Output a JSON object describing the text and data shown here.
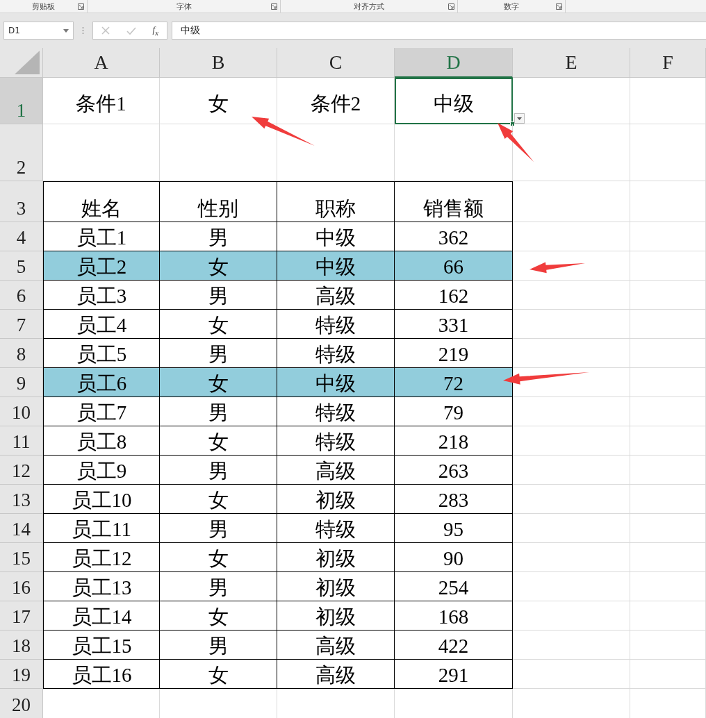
{
  "ribbon_groups": [
    {
      "label": "剪贴板"
    },
    {
      "label": "字体"
    },
    {
      "label": "对齐方式"
    },
    {
      "label": "数字"
    }
  ],
  "formula_bar": {
    "name_box": "D1",
    "function_label": "f$_{x}$",
    "formula": "中级"
  },
  "columns": [
    {
      "label": "A",
      "selected": false
    },
    {
      "label": "B",
      "selected": false
    },
    {
      "label": "C",
      "selected": false
    },
    {
      "label": "D",
      "selected": true
    },
    {
      "label": "E",
      "selected": false
    },
    {
      "label": "F",
      "selected": false
    }
  ],
  "rows": [
    {
      "number": "1",
      "kind": "criteria",
      "selected": true,
      "cells": [
        {
          "text": "条件1",
          "selected": false
        },
        {
          "text": "女",
          "selected": false
        },
        {
          "text": "条件2",
          "selected": false
        },
        {
          "text": "中级",
          "selected": true
        }
      ]
    },
    {
      "number": "2",
      "kind": "blank",
      "selected": false
    },
    {
      "number": "3",
      "kind": "header",
      "selected": false,
      "cells": [
        {
          "text": "姓名"
        },
        {
          "text": "性别"
        },
        {
          "text": "职称"
        },
        {
          "text": "销售额"
        }
      ]
    },
    {
      "number": "4",
      "kind": "data",
      "selected": false,
      "highlighted": false,
      "cells": [
        {
          "text": "员工1"
        },
        {
          "text": "男"
        },
        {
          "text": "中级"
        },
        {
          "text": "362"
        }
      ]
    },
    {
      "number": "5",
      "kind": "data",
      "selected": false,
      "highlighted": true,
      "cells": [
        {
          "text": "员工2"
        },
        {
          "text": "女"
        },
        {
          "text": "中级"
        },
        {
          "text": "66"
        }
      ]
    },
    {
      "number": "6",
      "kind": "data",
      "selected": false,
      "highlighted": false,
      "cells": [
        {
          "text": "员工3"
        },
        {
          "text": "男"
        },
        {
          "text": "高级"
        },
        {
          "text": "162"
        }
      ]
    },
    {
      "number": "7",
      "kind": "data",
      "selected": false,
      "highlighted": false,
      "cells": [
        {
          "text": "员工4"
        },
        {
          "text": "女"
        },
        {
          "text": "特级"
        },
        {
          "text": "331"
        }
      ]
    },
    {
      "number": "8",
      "kind": "data",
      "selected": false,
      "highlighted": false,
      "cells": [
        {
          "text": "员工5"
        },
        {
          "text": "男"
        },
        {
          "text": "特级"
        },
        {
          "text": "219"
        }
      ]
    },
    {
      "number": "9",
      "kind": "data",
      "selected": false,
      "highlighted": true,
      "cells": [
        {
          "text": "员工6"
        },
        {
          "text": "女"
        },
        {
          "text": "中级"
        },
        {
          "text": "72"
        }
      ]
    },
    {
      "number": "10",
      "kind": "data",
      "selected": false,
      "highlighted": false,
      "cells": [
        {
          "text": "员工7"
        },
        {
          "text": "男"
        },
        {
          "text": "特级"
        },
        {
          "text": "79"
        }
      ]
    },
    {
      "number": "11",
      "kind": "data",
      "selected": false,
      "highlighted": false,
      "cells": [
        {
          "text": "员工8"
        },
        {
          "text": "女"
        },
        {
          "text": "特级"
        },
        {
          "text": "218"
        }
      ]
    },
    {
      "number": "12",
      "kind": "data",
      "selected": false,
      "highlighted": false,
      "cells": [
        {
          "text": "员工9"
        },
        {
          "text": "男"
        },
        {
          "text": "高级"
        },
        {
          "text": "263"
        }
      ]
    },
    {
      "number": "13",
      "kind": "data",
      "selected": false,
      "highlighted": false,
      "cells": [
        {
          "text": "员工10"
        },
        {
          "text": "女"
        },
        {
          "text": "初级"
        },
        {
          "text": "283"
        }
      ]
    },
    {
      "number": "14",
      "kind": "data",
      "selected": false,
      "highlighted": false,
      "cells": [
        {
          "text": "员工11"
        },
        {
          "text": "男"
        },
        {
          "text": "特级"
        },
        {
          "text": "95"
        }
      ]
    },
    {
      "number": "15",
      "kind": "data",
      "selected": false,
      "highlighted": false,
      "cells": [
        {
          "text": "员工12"
        },
        {
          "text": "女"
        },
        {
          "text": "初级"
        },
        {
          "text": "90"
        }
      ]
    },
    {
      "number": "16",
      "kind": "data",
      "selected": false,
      "highlighted": false,
      "cells": [
        {
          "text": "员工13"
        },
        {
          "text": "男"
        },
        {
          "text": "初级"
        },
        {
          "text": "254"
        }
      ]
    },
    {
      "number": "17",
      "kind": "data",
      "selected": false,
      "highlighted": false,
      "cells": [
        {
          "text": "员工14"
        },
        {
          "text": "女"
        },
        {
          "text": "初级"
        },
        {
          "text": "168"
        }
      ]
    },
    {
      "number": "18",
      "kind": "data",
      "selected": false,
      "highlighted": false,
      "cells": [
        {
          "text": "员工15"
        },
        {
          "text": "男"
        },
        {
          "text": "高级"
        },
        {
          "text": "422"
        }
      ]
    },
    {
      "number": "19",
      "kind": "data",
      "selected": false,
      "highlighted": false,
      "cells": [
        {
          "text": "员工16"
        },
        {
          "text": "女"
        },
        {
          "text": "高级"
        },
        {
          "text": "291"
        }
      ]
    },
    {
      "number": "20",
      "kind": "blank",
      "selected": false
    }
  ]
}
